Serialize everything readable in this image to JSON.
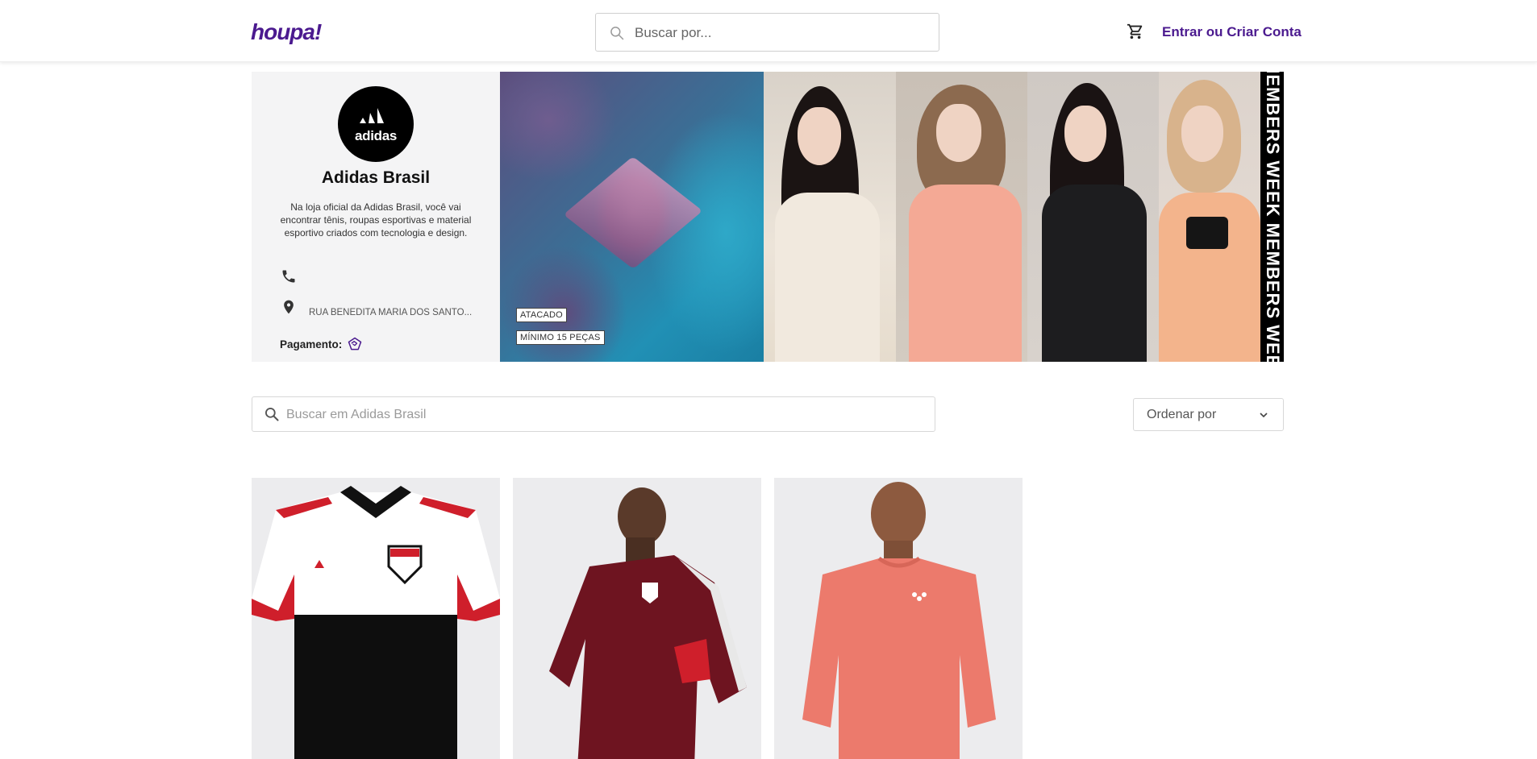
{
  "header": {
    "logo_text": "houpa!",
    "search_placeholder": "Buscar por...",
    "login_label": "Entrar ou Criar Conta",
    "accent_color": "#4b1a8f"
  },
  "store": {
    "avatar_text": "adidas",
    "name": "Adidas Brasil",
    "description": "Na loja oficial da Adidas Brasil, você vai encontrar tênis, roupas esportivas e material esportivo criados com tecnologia e design.",
    "address": "RUA BENEDITA MARIA DOS SANTO...",
    "payment_label": "Pagamento:"
  },
  "banner": {
    "tag_wholesale": "ATACADO",
    "tag_minimum": "MÍNIMO 15 PEÇAS",
    "side_text": "MEMBERS WEEK MEMBERS WEEK"
  },
  "store_search": {
    "placeholder": "Buscar em Adidas Brasil"
  },
  "sort": {
    "label": "Ordenar por"
  },
  "icons": {
    "search": "search-icon",
    "cart": "cart-icon",
    "phone": "phone-icon",
    "location": "location-pin-icon",
    "payment": "handshake-icon",
    "chevron": "chevron-down-icon"
  }
}
